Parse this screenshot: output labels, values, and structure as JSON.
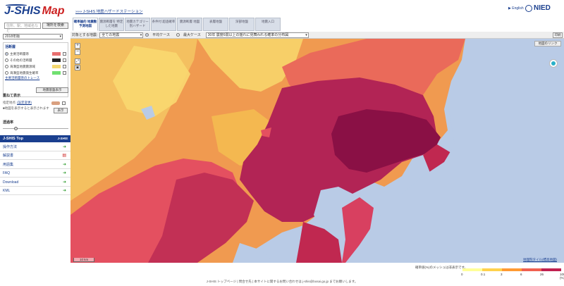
{
  "header": {
    "logo_j": "J-SHIS",
    "logo_map": "Map",
    "breadcrumb": "»»» J-SHIS 地震ハザードステーション",
    "lang": "▶ English",
    "nied": "NIED",
    "search_placeholder": "住所、駅、地域名など",
    "search_button": "場所を検索"
  },
  "tabs": [
    {
      "label": "確率論的 地震動予測地図",
      "active": true
    },
    {
      "label": "震源断層を 特定した地震",
      "active": false
    },
    {
      "label": "地震カテゴリー 別ハザード",
      "active": false
    },
    {
      "label": "条件付 超過確率",
      "active": false
    },
    {
      "label": "震源断層 地図",
      "active": false
    },
    {
      "label": "表層地盤",
      "active": false
    },
    {
      "label": "深部地盤",
      "active": false
    },
    {
      "label": "地震入口",
      "active": false
    }
  ],
  "sidebar": {
    "year": "2018年版",
    "legend_title": "活断層",
    "legend_items": [
      {
        "label": "主要活断層帯",
        "color": "#e87070",
        "selected": true
      },
      {
        "label": "その他の活断層",
        "color": "#222222",
        "selected": false
      },
      {
        "label": "海溝型地震震源域",
        "color": "#f4d870",
        "selected": false
      },
      {
        "label": "海溝型地震発生確率",
        "color": "#70e070",
        "selected": false
      }
    ],
    "legend_link": "主要活断層帯のトレース",
    "legend_button": "地震基盤表示",
    "overlay_title": "重ねて表示",
    "overlay_item": "指定地点",
    "overlay_link": "(設定変更)",
    "overlay_note": "■地図を表示すると表示されます",
    "overlay_button": "表示",
    "opacity_title": "透過率",
    "opacity_value": 0.18,
    "nav_title": "J-SHIS Top",
    "nav_sub": "J-SHIS",
    "nav_items": [
      {
        "label": "操作方法",
        "icon": "arrow-icon"
      },
      {
        "label": "解説書",
        "icon": "pdf-icon"
      },
      {
        "label": "用語集",
        "icon": "arrow-icon"
      },
      {
        "label": "FAQ",
        "icon": "arrow-icon"
      },
      {
        "label": "Download",
        "icon": "arrow-icon"
      },
      {
        "label": "KML",
        "icon": "arrow-icon"
      }
    ]
  },
  "toolbar": {
    "target_label": "対象とする地震:",
    "target_value": "全ての地震",
    "case_avg": "平均ケース",
    "case_max": "最大ケース",
    "measure_value": "30年 震度6弱以上の揺れに見舞われる確率の分布図",
    "print": "印刷"
  },
  "map": {
    "link_button": "地図のリンク",
    "scale": "10 km",
    "attribution": "地理院タイル(標高地図)"
  },
  "colorbar": {
    "note": "確率値(%)のメッシュは非表示です。",
    "stops": [
      {
        "label": "0",
        "color": "#ffff99"
      },
      {
        "label": "0.1",
        "color": "#ffd24d"
      },
      {
        "label": "3",
        "color": "#ff9a33"
      },
      {
        "label": "6",
        "color": "#f06050"
      },
      {
        "label": "26",
        "color": "#c02050"
      },
      {
        "label": "100 (%)",
        "color": "#7a0a40"
      }
    ]
  },
  "footer": {
    "text": "J-SHIS トップページ | 問合せ先 | 本サイトに関するお問い合わせは j-shis@bosai.go.jp までお願いします。"
  }
}
